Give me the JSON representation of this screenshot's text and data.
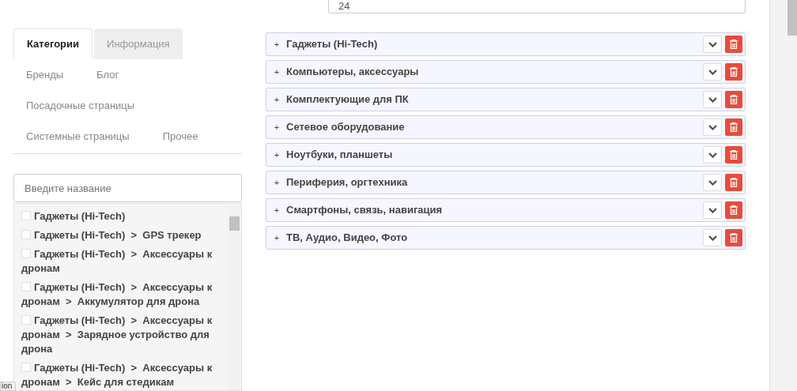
{
  "top_field": {
    "value": "24"
  },
  "tabs": [
    {
      "label": "Категории",
      "selected": true
    },
    {
      "label": "Информация",
      "selected": false
    },
    {
      "label": "Бренды",
      "selected": false
    },
    {
      "label": "Блог",
      "selected": false
    },
    {
      "label": "Посадочные страницы",
      "selected": false
    },
    {
      "label": "Системные страницы",
      "selected": false
    },
    {
      "label": "Прочее",
      "selected": false
    }
  ],
  "search": {
    "placeholder": "Введите название"
  },
  "category_list": [
    {
      "label": "Гаджеты (Hi-Tech)",
      "checked": false
    },
    {
      "label": "Гаджеты (Hi-Tech)  >  GPS трекер",
      "checked": false
    },
    {
      "label": "Гаджеты (Hi-Tech)  >  Аксессуары к дронам",
      "checked": false
    },
    {
      "label": "Гаджеты (Hi-Tech)  >  Аксессуары к дронам  >  Аккумулятор для дрона",
      "checked": false
    },
    {
      "label": "Гаджеты (Hi-Tech)  >  Аксессуары к дронам  >  Зарядное устройство для дрона",
      "checked": false
    },
    {
      "label": "Гаджеты (Hi-Tech)  >  Аксессуары к дронам  >  Кейс для стедикам",
      "checked": false
    }
  ],
  "selected_categories": [
    {
      "expander": "+",
      "label": "Гаджеты (Hi-Tech)"
    },
    {
      "expander": "+",
      "label": "Компьютеры, аксессуары"
    },
    {
      "expander": "+",
      "label": "Комплектующие для ПК"
    },
    {
      "expander": "+",
      "label": "Сетевое оборудование"
    },
    {
      "expander": "+",
      "label": "Ноутбуки, планшеты"
    },
    {
      "expander": "+",
      "label": "Периферия, оргтехника"
    },
    {
      "expander": "+",
      "label": "Смартфоны, связь, навигация"
    },
    {
      "expander": "+",
      "label": "ТВ, Аудио, Видео, Фото"
    }
  ],
  "tooltip": "ion"
}
